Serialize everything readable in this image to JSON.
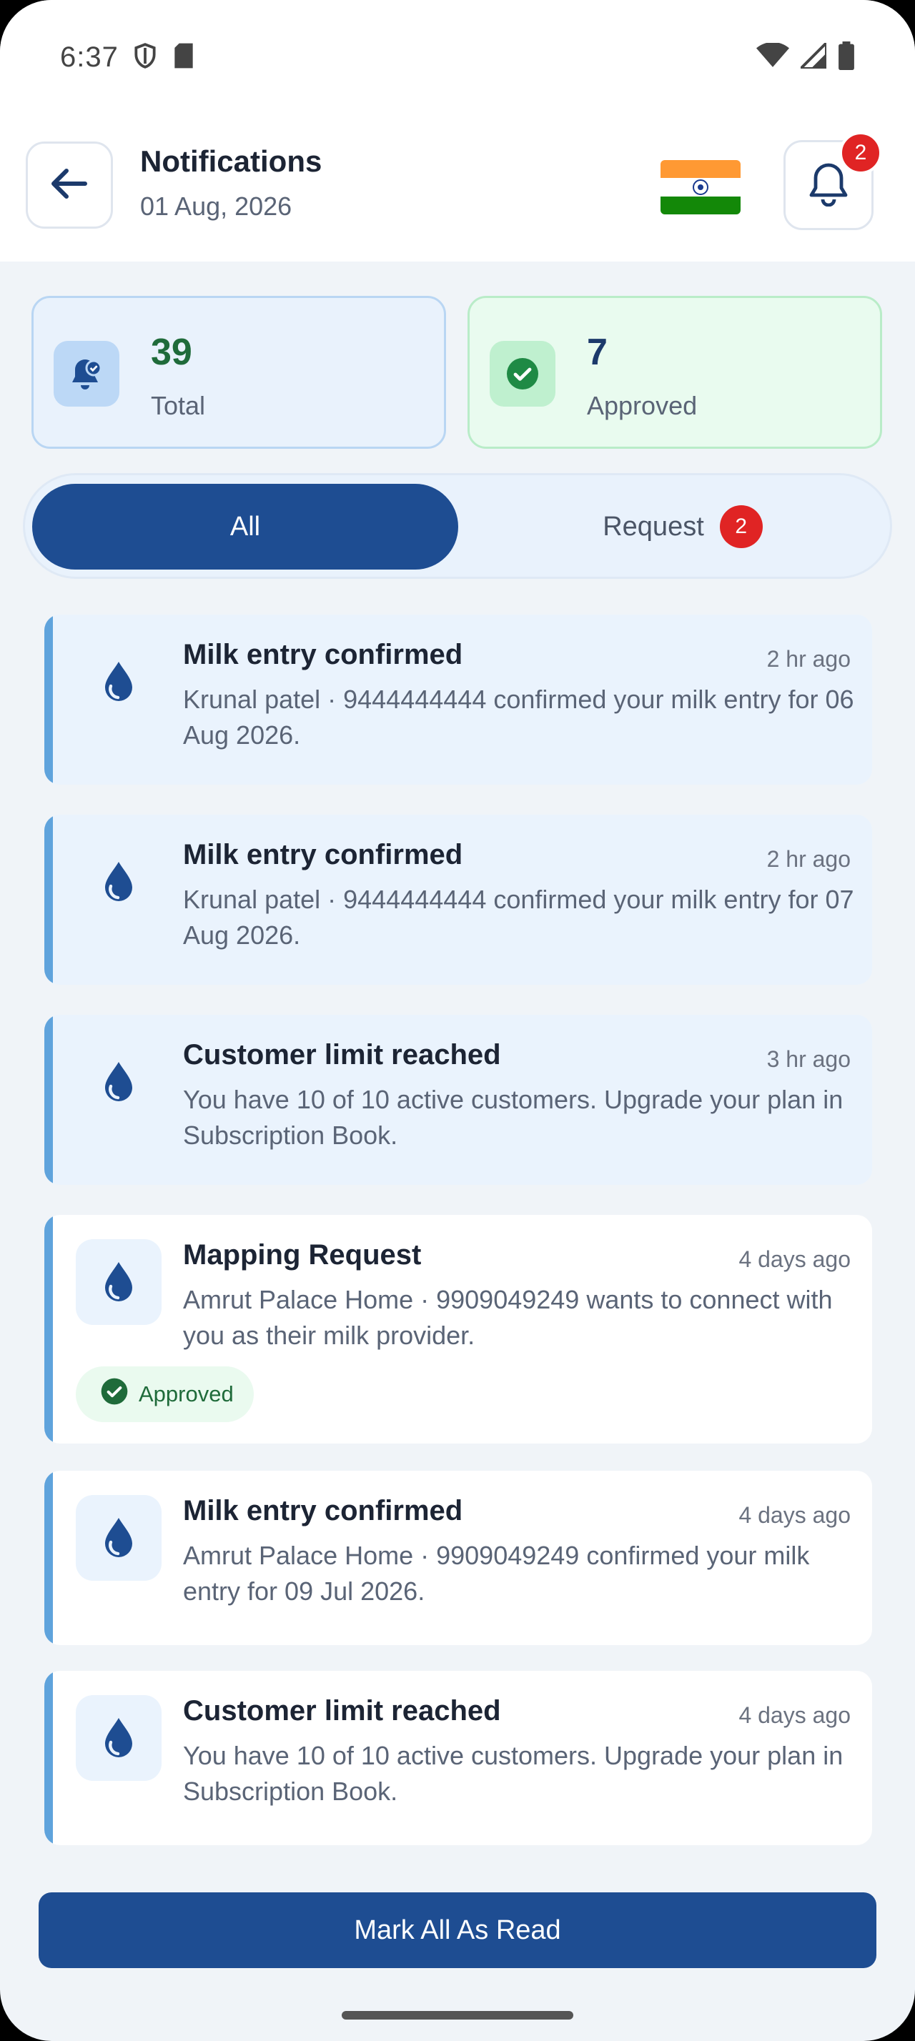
{
  "status_bar": {
    "time": "6:37"
  },
  "header": {
    "title": "Notifications",
    "date": "01 Aug, 2026",
    "bell_badge": "2"
  },
  "stats": {
    "total": {
      "value": "39",
      "label": "Total"
    },
    "approved": {
      "value": "7",
      "label": "Approved"
    }
  },
  "tabs": {
    "all_label": "All",
    "request_label": "Request",
    "request_badge": "2"
  },
  "notifications": [
    {
      "title": "Milk entry confirmed",
      "time": "2 hr ago",
      "body": "Krunal patel · 9444444444 confirmed your milk entry for 06 Aug 2026."
    },
    {
      "title": "Milk entry confirmed",
      "time": "2 hr ago",
      "body": "Krunal patel · 9444444444 confirmed your milk entry for 07 Aug 2026."
    },
    {
      "title": "Customer limit reached",
      "time": "3 hr ago",
      "body": "You have 10 of 10 active customers. Upgrade your plan in Subscription Book."
    },
    {
      "title": "Mapping Request",
      "time": "4 days ago",
      "body": "Amrut Palace Home · 9909049249 wants to connect with you as their milk provider.",
      "status": "Approved"
    },
    {
      "title": "Milk entry confirmed",
      "time": "4 days ago",
      "body": "Amrut Palace Home · 9909049249 confirmed your milk entry for 09 Jul 2026."
    },
    {
      "title": "Customer limit reached",
      "time": "4 days ago",
      "body": "You have 10 of 10 active customers. Upgrade your plan in Subscription Book."
    }
  ],
  "footer": {
    "mark_all_label": "Mark All As Read"
  },
  "colors": {
    "primary": "#1e4d92",
    "badge": "#e02424",
    "accent_bar": "#5fa3dc",
    "approved_green": "#1f6b3a"
  }
}
